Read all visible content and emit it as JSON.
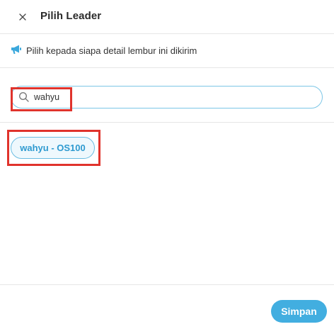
{
  "header": {
    "title": "Pilih Leader",
    "close_icon": "close-icon"
  },
  "info": {
    "icon": "megaphone-icon",
    "text": "Pilih kepada siapa detail lembur ini dikirim"
  },
  "search": {
    "icon": "search-icon",
    "value": "wahyu",
    "placeholder": ""
  },
  "results": [
    {
      "label": "wahyu - OS100",
      "selected": false
    }
  ],
  "footer": {
    "save_label": "Simpan"
  },
  "colors": {
    "accent": "#42aee0",
    "chip_border": "#6bbde2",
    "chip_text": "#2e9ad0",
    "highlight_box": "#e0332c"
  }
}
